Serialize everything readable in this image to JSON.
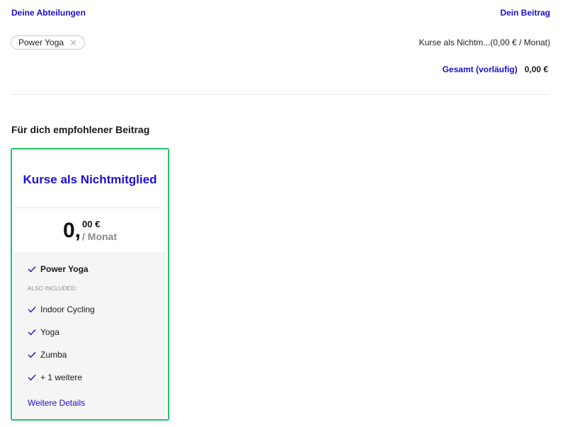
{
  "header": {
    "departments_label": "Deine Abteilungen",
    "contribution_label": "Dein Beitrag"
  },
  "selected_department": {
    "label": "Power Yoga",
    "remove_icon": "close-icon"
  },
  "summary": {
    "line": "Kurse als Nichtm...(0,00 € / Monat)",
    "total_label": "Gesamt (vorläufig)",
    "total_value": "0,00 €"
  },
  "recommended": {
    "section_title": "Für dich empfohlener Beitrag",
    "card": {
      "title": "Kurse als Nichtmitglied",
      "price_main": "0,",
      "price_cents": "00 €",
      "price_period": "/ Monat",
      "main_feature": "Power Yoga",
      "also_included_label": "ALSO INCLUDED:",
      "included": [
        "Indoor Cycling",
        "Yoga",
        "Zumba",
        "+ 1 weitere"
      ],
      "details_link": "Weitere Details",
      "border_color": "#22c46a",
      "accent_color": "#1a0fd6"
    }
  }
}
